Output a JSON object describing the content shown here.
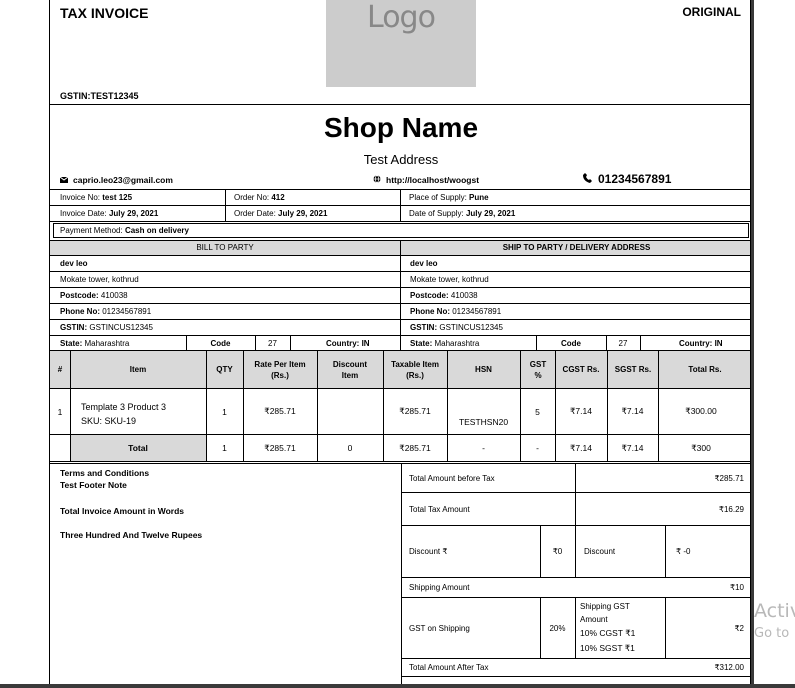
{
  "header": {
    "title": "TAX INVOICE",
    "copy_label": "ORIGINAL",
    "logo_text": "Logo",
    "gstin": "GSTIN:TEST12345",
    "shop_name": "Shop Name",
    "address": "Test Address"
  },
  "contact": {
    "email": "caprio.leo23@gmail.com",
    "website": "http://localhost/woogst",
    "phone": "01234567891"
  },
  "order": {
    "invoice_no_label": "Invoice No:",
    "invoice_no": "test 125",
    "order_no_label": "Order No:",
    "order_no": "412",
    "place_label": "Place of Supply:",
    "place": "Pune",
    "invoice_date_label": "Invoice Date:",
    "invoice_date": "July 29, 2021",
    "order_date_label": "Order Date:",
    "order_date": "July 29, 2021",
    "supply_date_label": "Date of Supply:",
    "supply_date": "July 29, 2021",
    "payment_label": "Payment Method:",
    "payment": "Cash on delivery"
  },
  "bill": {
    "heading": "BILL TO PARTY",
    "name": "dev leo",
    "address": "Mokate tower, kothrud",
    "postcode_label": "Postcode:",
    "postcode": "410038",
    "phone_label": "Phone No:",
    "phone": "01234567891",
    "gstin_label": "GSTIN:",
    "gstin": "GSTINCUS12345",
    "state_label": "State:",
    "state": "Maharashtra",
    "code_label": "Code",
    "code": "27",
    "country_label": "Country:",
    "country": "IN"
  },
  "ship": {
    "heading": "SHIP TO PARTY / DELIVERY ADDRESS",
    "name": "dev leo",
    "address": "Mokate tower, kothrud",
    "postcode_label": "Postcode:",
    "postcode": "410038",
    "phone_label": "Phone No:",
    "phone": "01234567891",
    "gstin_label": "GSTIN:",
    "gstin": "GSTINCUS12345",
    "state_label": "State:",
    "state": "Maharashtra",
    "code_label": "Code",
    "code": "27",
    "country_label": "Country:",
    "country": "IN"
  },
  "items": {
    "columns": [
      "#",
      "Item",
      "QTY",
      "Rate Per Item (Rs.)",
      "Discount Item",
      "Taxable Item (Rs.)",
      "HSN",
      "GST %",
      "CGST Rs.",
      "SGST Rs.",
      "Total Rs."
    ],
    "rows": [
      {
        "num": "1",
        "item": "Template 3 Product 3",
        "sku": "SKU: SKU-19",
        "qty": "1",
        "rate": "₹285.71",
        "discount": "",
        "taxable": "₹285.71",
        "hsn": "TESTHSN20",
        "gst": "5",
        "cgst": "₹7.14",
        "sgst": "₹7.14",
        "total": "₹300.00"
      }
    ],
    "total_row": {
      "label": "Total",
      "qty": "1",
      "rate": "₹285.71",
      "discount": "0",
      "taxable": "₹285.71",
      "hsn": "-",
      "gst": "-",
      "cgst": "₹7.14",
      "sgst": "₹7.14",
      "total": "₹300"
    }
  },
  "footer": {
    "terms": "Terms and Conditions",
    "footer_note": "Test Footer Note",
    "words_label": "Total Invoice Amount in Words",
    "words": "Three Hundred And Twelve Rupees"
  },
  "summary": {
    "before_tax_label": "Total Amount before Tax",
    "before_tax": "₹285.71",
    "tax_label": "Total Tax Amount",
    "tax": "₹16.29",
    "discount_label": "Discount ₹",
    "discount_value": "₹0",
    "discount_label2": "Discount",
    "discount_value2": "₹ -0",
    "shipping_label": "Shipping Amount",
    "shipping": "₹10",
    "gst_shipping_label": "GST on Shipping",
    "gst_shipping_rate": "20%",
    "shipping_gst_title": "Shipping GST Amount",
    "shipping_cgst": "10% CGST ₹1",
    "shipping_sgst": "10% SGST ₹1",
    "gst_shipping_value": "₹2",
    "after_tax_label": "Total Amount After Tax",
    "after_tax": "₹312.00"
  },
  "overlay": {
    "activate_1": "Activ",
    "activate_2": "Go to"
  }
}
